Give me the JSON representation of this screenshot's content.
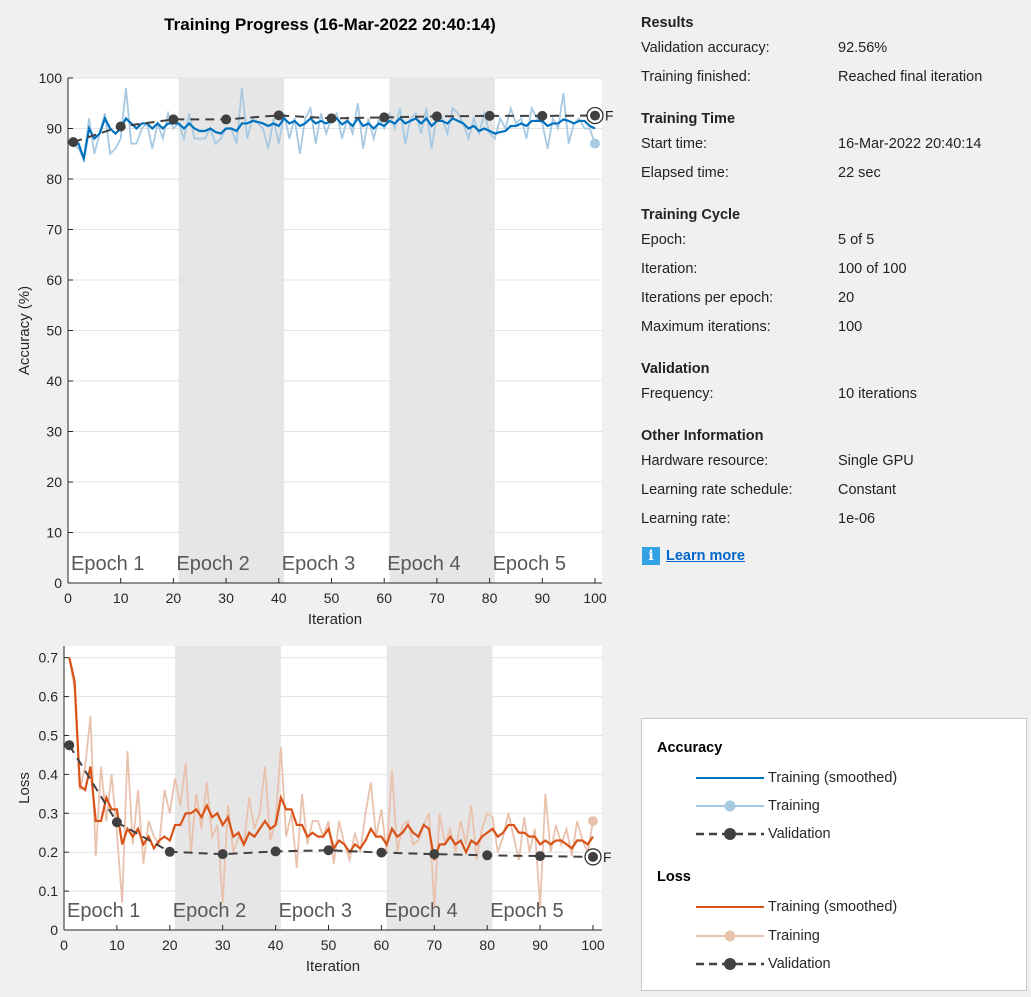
{
  "title": "Training Progress (16-Mar-2022 20:40:14)",
  "results": {
    "heading": "Results",
    "rows": [
      {
        "label": "Validation accuracy:",
        "value": "92.56%"
      },
      {
        "label": "Training finished:",
        "value": "Reached final iteration"
      }
    ]
  },
  "training_time": {
    "heading": "Training Time",
    "rows": [
      {
        "label": "Start time:",
        "value": "16-Mar-2022 20:40:14"
      },
      {
        "label": "Elapsed time:",
        "value": "22 sec"
      }
    ]
  },
  "training_cycle": {
    "heading": "Training Cycle",
    "rows": [
      {
        "label": "Epoch:",
        "value": "5 of 5"
      },
      {
        "label": "Iteration:",
        "value": "100 of 100"
      },
      {
        "label": "Iterations per epoch:",
        "value": "20"
      },
      {
        "label": "Maximum iterations:",
        "value": "100"
      }
    ]
  },
  "validation": {
    "heading": "Validation",
    "rows": [
      {
        "label": "Frequency:",
        "value": "10 iterations"
      }
    ]
  },
  "other_info": {
    "heading": "Other Information",
    "rows": [
      {
        "label": "Hardware resource:",
        "value": "Single GPU"
      },
      {
        "label": "Learning rate schedule:",
        "value": "Constant"
      },
      {
        "label": "Learning rate:",
        "value": "1e-06"
      }
    ]
  },
  "learn_more": {
    "icon": "info-icon",
    "label": "Learn more"
  },
  "legend": {
    "accuracy_heading": "Accuracy",
    "loss_heading": "Loss",
    "smoothed": "Training (smoothed)",
    "training": "Training",
    "validation": "Validation"
  },
  "colors": {
    "acc_smoothed": "#0072bd",
    "acc_training": "#a8c9e2",
    "loss_smoothed": "#d95319",
    "loss_training": "#e9c2ae",
    "validation": "#404040",
    "epoch_shade": "#e6e6e6"
  },
  "chart_data": [
    {
      "type": "line",
      "xlabel": "Iteration",
      "ylabel": "Accuracy (%)",
      "xlim": [
        0,
        100
      ],
      "ylim": [
        0,
        100
      ],
      "xticks": [
        0,
        10,
        20,
        30,
        40,
        50,
        60,
        70,
        80,
        90,
        100
      ],
      "yticks": [
        0,
        10,
        20,
        30,
        40,
        50,
        60,
        70,
        80,
        90,
        100
      ],
      "grid": "horizontal",
      "epochs": [
        "Epoch 1",
        "Epoch 2",
        "Epoch 3",
        "Epoch 4",
        "Epoch 5"
      ],
      "final_marker_label": "F",
      "series": [
        {
          "name": "Training",
          "x": [
            1,
            2,
            3,
            4,
            5,
            6,
            7,
            8,
            9,
            10,
            11,
            12,
            13,
            14,
            15,
            16,
            17,
            18,
            19,
            20,
            21,
            22,
            23,
            24,
            25,
            26,
            27,
            28,
            29,
            30,
            31,
            32,
            33,
            34,
            35,
            36,
            37,
            38,
            39,
            40,
            41,
            42,
            43,
            44,
            45,
            46,
            47,
            48,
            49,
            50,
            51,
            52,
            53,
            54,
            55,
            56,
            57,
            58,
            59,
            60,
            61,
            62,
            63,
            64,
            65,
            66,
            67,
            68,
            69,
            70,
            71,
            72,
            73,
            74,
            75,
            76,
            77,
            78,
            79,
            80,
            81,
            82,
            83,
            84,
            85,
            86,
            87,
            88,
            89,
            90,
            91,
            92,
            93,
            94,
            95,
            96,
            97,
            98,
            99,
            100
          ],
          "values": [
            87,
            86,
            84,
            92,
            85,
            89,
            93,
            85,
            86,
            88,
            98,
            87,
            87,
            90,
            91,
            86,
            91,
            88,
            93,
            90,
            91,
            88,
            93,
            88,
            88,
            88,
            90,
            87,
            88,
            90,
            90,
            87,
            98,
            88,
            92,
            91,
            90,
            86,
            92,
            87,
            93,
            88,
            92,
            85,
            92,
            94,
            87,
            93,
            89,
            92,
            93,
            88,
            92,
            89,
            95,
            86,
            92,
            88,
            92,
            90,
            93,
            90,
            94,
            87,
            92,
            93,
            89,
            94,
            86,
            93,
            92,
            89,
            94,
            93,
            91,
            88,
            92,
            89,
            93,
            89,
            88,
            92,
            90,
            94,
            91,
            92,
            88,
            94,
            92,
            91,
            86,
            92,
            90,
            97,
            87,
            91,
            92,
            90,
            90,
            87
          ]
        },
        {
          "name": "Training (smoothed)",
          "x": [
            1,
            2,
            3,
            4,
            5,
            6,
            7,
            8,
            9,
            10,
            11,
            12,
            13,
            14,
            15,
            16,
            17,
            18,
            19,
            20,
            21,
            22,
            23,
            24,
            25,
            26,
            27,
            28,
            29,
            30,
            31,
            32,
            33,
            34,
            35,
            36,
            37,
            38,
            39,
            40,
            41,
            42,
            43,
            44,
            45,
            46,
            47,
            48,
            49,
            50,
            51,
            52,
            53,
            54,
            55,
            56,
            57,
            58,
            59,
            60,
            61,
            62,
            63,
            64,
            65,
            66,
            67,
            68,
            69,
            70,
            71,
            72,
            73,
            74,
            75,
            76,
            77,
            78,
            79,
            80,
            81,
            82,
            83,
            84,
            85,
            86,
            87,
            88,
            89,
            90,
            91,
            92,
            93,
            94,
            95,
            96,
            97,
            98,
            99,
            100
          ],
          "values": [
            87,
            87,
            84,
            90,
            88,
            89,
            92,
            90,
            89,
            90,
            92,
            91,
            90,
            91,
            91,
            90,
            91,
            90,
            91,
            91,
            91,
            90,
            91,
            90,
            89.5,
            89.5,
            90,
            89.3,
            89,
            90,
            90,
            89.5,
            91,
            91,
            91.5,
            91.3,
            91,
            90.5,
            91,
            90.5,
            92,
            91,
            91.5,
            90.5,
            91,
            92,
            91,
            91.5,
            91,
            91.5,
            92,
            90.8,
            91.5,
            90.5,
            92,
            90.5,
            91,
            90,
            91,
            90.5,
            91.5,
            91,
            92,
            91,
            91.5,
            92,
            91,
            92,
            90.5,
            91.5,
            91.5,
            91,
            92,
            91.5,
            91,
            90,
            90.5,
            89.5,
            90,
            89.5,
            89,
            89.3,
            89.5,
            90.5,
            90.5,
            91,
            90.5,
            91.5,
            91.5,
            91.5,
            90.5,
            91,
            91,
            91.8,
            91.5,
            91,
            91.5,
            91.5,
            90.5,
            90
          ]
        },
        {
          "name": "Validation",
          "x": [
            1,
            10,
            20,
            30,
            40,
            50,
            60,
            70,
            80,
            90,
            100
          ],
          "values": [
            87.3,
            90.4,
            91.8,
            91.8,
            92.6,
            92.0,
            92.2,
            92.4,
            92.5,
            92.5,
            92.56
          ]
        }
      ]
    },
    {
      "type": "line",
      "xlabel": "Iteration",
      "ylabel": "Loss",
      "xlim": [
        0,
        100
      ],
      "ylim": [
        0,
        0.73
      ],
      "xticks": [
        0,
        10,
        20,
        30,
        40,
        50,
        60,
        70,
        80,
        90,
        100
      ],
      "yticks": [
        0,
        0.1,
        0.2,
        0.3,
        0.4,
        0.5,
        0.6,
        0.7
      ],
      "grid": "horizontal",
      "epochs": [
        "Epoch 1",
        "Epoch 2",
        "Epoch 3",
        "Epoch 4",
        "Epoch 5"
      ],
      "final_marker_label": "F",
      "series": [
        {
          "name": "Training",
          "x": [
            1,
            2,
            3,
            4,
            5,
            6,
            7,
            8,
            9,
            10,
            11,
            12,
            13,
            14,
            15,
            16,
            17,
            18,
            19,
            20,
            21,
            22,
            23,
            24,
            25,
            26,
            27,
            28,
            29,
            30,
            31,
            32,
            33,
            34,
            35,
            36,
            37,
            38,
            39,
            40,
            41,
            42,
            43,
            44,
            45,
            46,
            47,
            48,
            49,
            50,
            51,
            52,
            53,
            54,
            55,
            56,
            57,
            58,
            59,
            60,
            61,
            62,
            63,
            64,
            65,
            66,
            67,
            68,
            69,
            70,
            71,
            72,
            73,
            74,
            75,
            76,
            77,
            78,
            79,
            80,
            81,
            82,
            83,
            84,
            85,
            86,
            87,
            88,
            89,
            90,
            91,
            92,
            93,
            94,
            95,
            96,
            97,
            98,
            99,
            100
          ],
          "values": [
            0.7,
            0.62,
            0.36,
            0.42,
            0.55,
            0.19,
            0.42,
            0.28,
            0.4,
            0.25,
            0.07,
            0.46,
            0.22,
            0.36,
            0.17,
            0.28,
            0.24,
            0.22,
            0.36,
            0.3,
            0.39,
            0.32,
            0.43,
            0.2,
            0.35,
            0.26,
            0.38,
            0.24,
            0.27,
            0.07,
            0.32,
            0.2,
            0.24,
            0.22,
            0.34,
            0.26,
            0.3,
            0.42,
            0.23,
            0.28,
            0.47,
            0.24,
            0.3,
            0.16,
            0.35,
            0.22,
            0.28,
            0.28,
            0.24,
            0.28,
            0.17,
            0.28,
            0.22,
            0.18,
            0.25,
            0.2,
            0.3,
            0.38,
            0.24,
            0.31,
            0.2,
            0.41,
            0.2,
            0.27,
            0.28,
            0.22,
            0.23,
            0.27,
            0.3,
            0.06,
            0.3,
            0.22,
            0.26,
            0.2,
            0.28,
            0.22,
            0.32,
            0.18,
            0.26,
            0.3,
            0.29,
            0.2,
            0.24,
            0.3,
            0.24,
            0.18,
            0.29,
            0.2,
            0.26,
            0.06,
            0.35,
            0.2,
            0.27,
            0.22,
            0.26,
            0.19,
            0.28,
            0.23,
            0.2,
            0.28
          ]
        },
        {
          "name": "Training (smoothed)",
          "x": [
            1,
            2,
            3,
            4,
            5,
            6,
            7,
            8,
            9,
            10,
            11,
            12,
            13,
            14,
            15,
            16,
            17,
            18,
            19,
            20,
            21,
            22,
            23,
            24,
            25,
            26,
            27,
            28,
            29,
            30,
            31,
            32,
            33,
            34,
            35,
            36,
            37,
            38,
            39,
            40,
            41,
            42,
            43,
            44,
            45,
            46,
            47,
            48,
            49,
            50,
            51,
            52,
            53,
            54,
            55,
            56,
            57,
            58,
            59,
            60,
            61,
            62,
            63,
            64,
            65,
            66,
            67,
            68,
            69,
            70,
            71,
            72,
            73,
            74,
            75,
            76,
            77,
            78,
            79,
            80,
            81,
            82,
            83,
            84,
            85,
            86,
            87,
            88,
            89,
            90,
            91,
            92,
            93,
            94,
            95,
            96,
            97,
            98,
            99,
            100
          ],
          "values": [
            0.7,
            0.64,
            0.37,
            0.36,
            0.42,
            0.28,
            0.28,
            0.34,
            0.31,
            0.31,
            0.22,
            0.26,
            0.24,
            0.26,
            0.22,
            0.24,
            0.21,
            0.23,
            0.24,
            0.23,
            0.27,
            0.27,
            0.3,
            0.3,
            0.31,
            0.29,
            0.32,
            0.29,
            0.3,
            0.27,
            0.29,
            0.24,
            0.25,
            0.22,
            0.25,
            0.24,
            0.26,
            0.28,
            0.26,
            0.27,
            0.34,
            0.31,
            0.31,
            0.27,
            0.27,
            0.24,
            0.25,
            0.24,
            0.24,
            0.26,
            0.21,
            0.23,
            0.22,
            0.2,
            0.22,
            0.21,
            0.23,
            0.26,
            0.24,
            0.24,
            0.22,
            0.26,
            0.24,
            0.25,
            0.27,
            0.25,
            0.24,
            0.27,
            0.26,
            0.18,
            0.22,
            0.22,
            0.24,
            0.22,
            0.23,
            0.2,
            0.23,
            0.22,
            0.24,
            0.25,
            0.26,
            0.24,
            0.25,
            0.27,
            0.27,
            0.25,
            0.25,
            0.24,
            0.24,
            0.22,
            0.23,
            0.22,
            0.23,
            0.23,
            0.22,
            0.21,
            0.23,
            0.23,
            0.22,
            0.24
          ]
        },
        {
          "name": "Validation",
          "x": [
            1,
            10,
            20,
            30,
            40,
            50,
            60,
            70,
            80,
            90,
            100
          ],
          "values": [
            0.475,
            0.277,
            0.201,
            0.195,
            0.202,
            0.205,
            0.199,
            0.195,
            0.192,
            0.19,
            0.188
          ]
        }
      ]
    }
  ]
}
